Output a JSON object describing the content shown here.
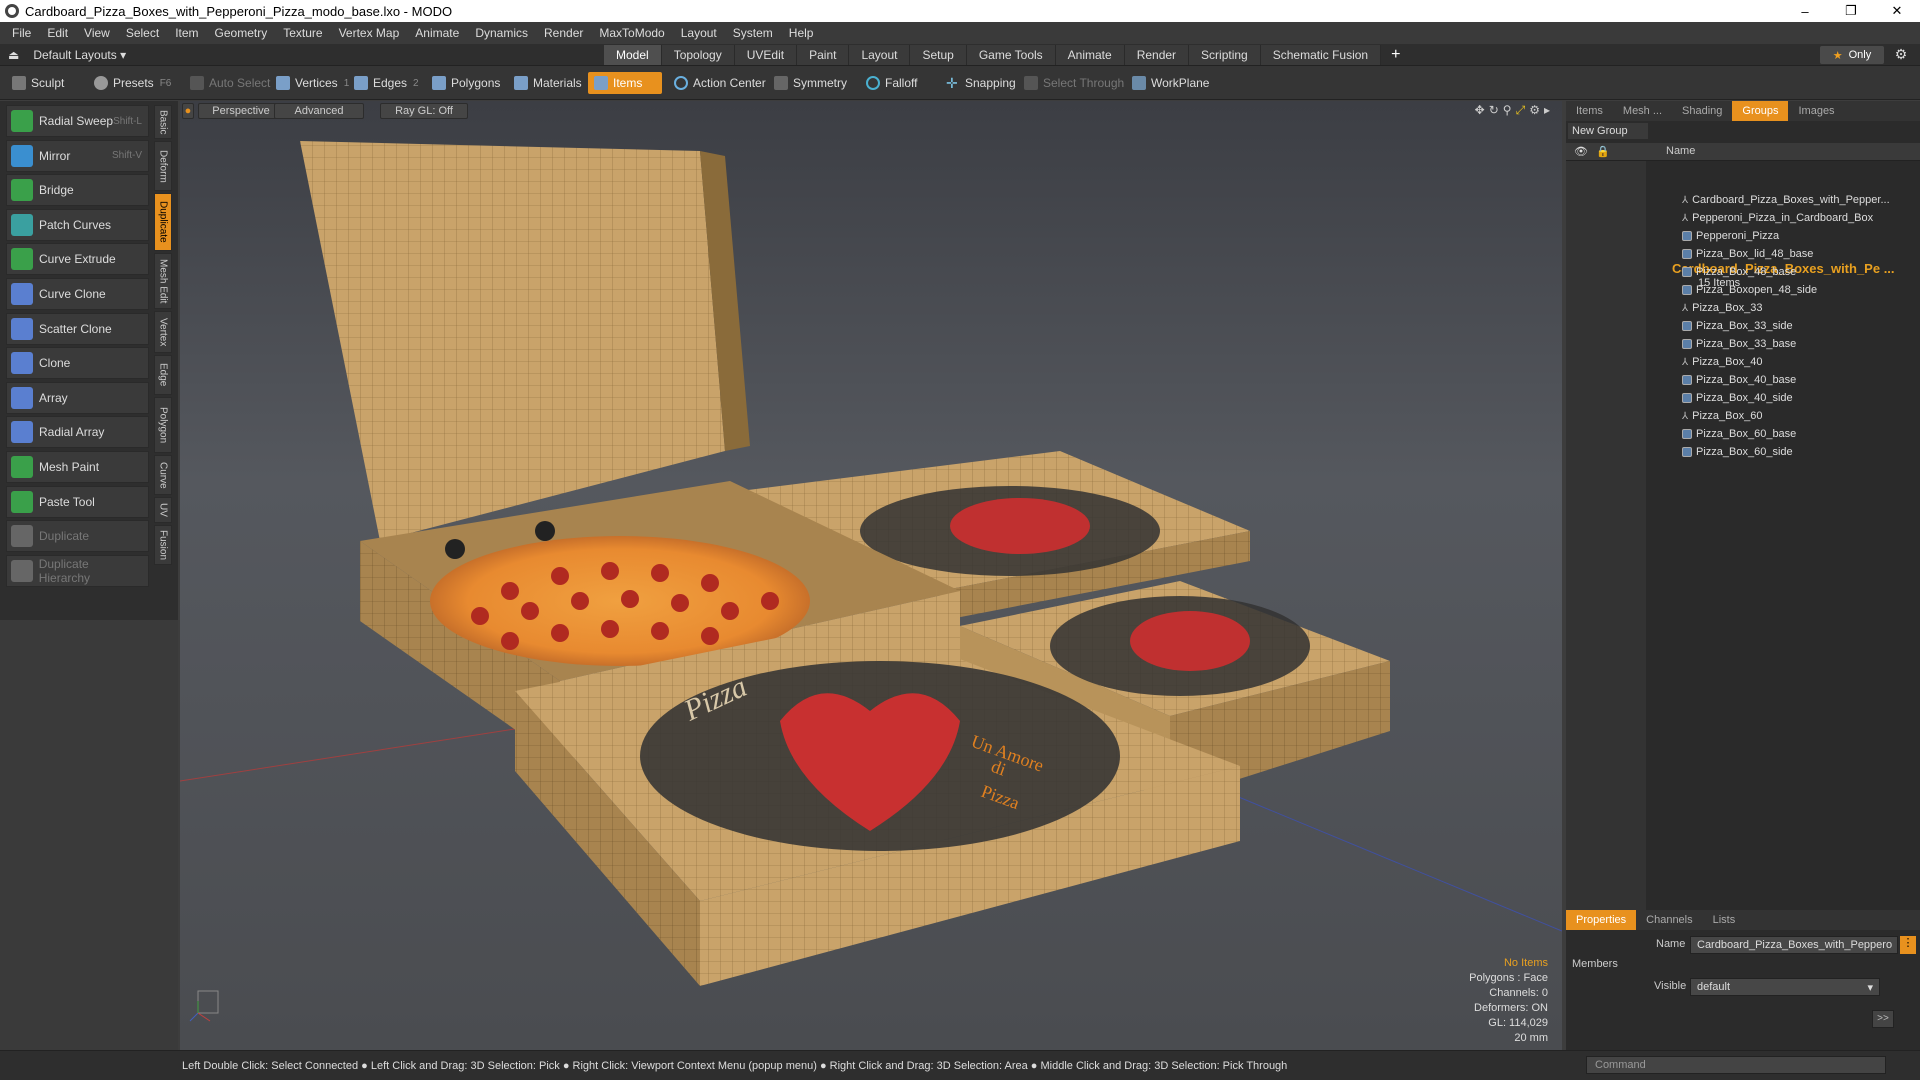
{
  "window": {
    "title": "Cardboard_Pizza_Boxes_with_Pepperoni_Pizza_modo_base.lxo - MODO",
    "minimize": "–",
    "restore": "❐",
    "close": "✕"
  },
  "menu": [
    "File",
    "Edit",
    "View",
    "Select",
    "Item",
    "Geometry",
    "Texture",
    "Vertex Map",
    "Animate",
    "Dynamics",
    "Render",
    "MaxToModo",
    "Layout",
    "System",
    "Help"
  ],
  "layouts": {
    "label": "Default Layouts ▾"
  },
  "mode_tabs": [
    {
      "label": "Model",
      "active": true
    },
    {
      "label": "Topology"
    },
    {
      "label": "UVEdit"
    },
    {
      "label": "Paint"
    },
    {
      "label": "Layout"
    },
    {
      "label": "Setup"
    },
    {
      "label": "Game Tools"
    },
    {
      "label": "Animate"
    },
    {
      "label": "Render"
    },
    {
      "label": "Scripting"
    },
    {
      "label": "Schematic Fusion"
    }
  ],
  "only_label": "Only",
  "toolbar": {
    "sculpt": "Sculpt",
    "presets": "Presets",
    "presets_key": "F6",
    "auto_select": "Auto Select",
    "vertices": "Vertices",
    "vertices_count": "1",
    "edges": "Edges",
    "edges_count": "2",
    "polygons": "Polygons",
    "materials": "Materials",
    "items": "Items",
    "action_center": "Action Center",
    "symmetry": "Symmetry",
    "falloff": "Falloff",
    "snapping": "Snapping",
    "select_through": "Select Through",
    "workplane": "WorkPlane"
  },
  "tools": [
    {
      "label": "Radial Sweep",
      "shortcut": "Shift-L",
      "color": "#3aa04a"
    },
    {
      "label": "Mirror",
      "shortcut": "Shift-V",
      "color": "#3a8fd0"
    },
    {
      "label": "Bridge",
      "shortcut": "",
      "color": "#3aa04a"
    },
    {
      "label": "Patch Curves",
      "shortcut": "",
      "color": "#3aa0a0"
    },
    {
      "label": "Curve Extrude",
      "shortcut": "",
      "color": "#3aa04a"
    },
    {
      "label": "Curve Clone",
      "shortcut": "",
      "color": "#5a7fd0"
    },
    {
      "label": "Scatter Clone",
      "shortcut": "",
      "color": "#5a7fd0"
    },
    {
      "label": "Clone",
      "shortcut": "",
      "color": "#5a7fd0"
    },
    {
      "label": "Array",
      "shortcut": "",
      "color": "#5a7fd0"
    },
    {
      "label": "Radial Array",
      "shortcut": "",
      "color": "#5a7fd0"
    },
    {
      "label": "Mesh Paint",
      "shortcut": "",
      "color": "#3aa04a"
    },
    {
      "label": "Paste Tool",
      "shortcut": "",
      "color": "#3aa04a"
    },
    {
      "label": "Duplicate",
      "shortcut": "",
      "color": "#666666",
      "disabled": true
    },
    {
      "label": "Duplicate Hierarchy",
      "shortcut": "",
      "color": "#666666",
      "disabled": true
    }
  ],
  "side_tabs": [
    {
      "label": "Basic"
    },
    {
      "label": "Deform"
    },
    {
      "label": "Duplicate",
      "active": true
    },
    {
      "label": "Mesh Edit"
    },
    {
      "label": "Vertex"
    },
    {
      "label": "Edge"
    },
    {
      "label": "Polygon"
    },
    {
      "label": "Curve"
    },
    {
      "label": "UV"
    },
    {
      "label": "Fusion"
    }
  ],
  "viewport": {
    "perspective": "Perspective",
    "advanced": "Advanced",
    "raygl": "Ray GL: Off",
    "stats": {
      "no_items": "No Items",
      "polygons": "Polygons : Face",
      "channels": "Channels: 0",
      "deformers": "Deformers: ON",
      "gl": "GL: 114,029",
      "scale": "20 mm"
    },
    "box_text": {
      "brand": "Pizza",
      "slogan1": "Un Amore",
      "slogan2": "di",
      "slogan3": "Pizza"
    }
  },
  "right_tabs": [
    {
      "label": "Items"
    },
    {
      "label": "Mesh ..."
    },
    {
      "label": "Shading"
    },
    {
      "label": "Groups",
      "active": true
    },
    {
      "label": "Images"
    }
  ],
  "new_group": "New Group",
  "list_header": "Name",
  "group": {
    "name": "Cardboard_Pizza_Boxes_with_Pe ...",
    "count": "15 Items"
  },
  "items": [
    {
      "label": "Cardboard_Pizza_Boxes_with_Pepper...",
      "type": "locator"
    },
    {
      "label": "Pepperoni_Pizza_in_Cardboard_Box",
      "type": "locator"
    },
    {
      "label": "Pepperoni_Pizza",
      "type": "mesh"
    },
    {
      "label": "Pizza_Box_lid_48_base",
      "type": "mesh"
    },
    {
      "label": "Pizza_Box_48_base",
      "type": "mesh"
    },
    {
      "label": "Pizza_Boxopen_48_side",
      "type": "mesh"
    },
    {
      "label": "Pizza_Box_33",
      "type": "locator"
    },
    {
      "label": "Pizza_Box_33_side",
      "type": "mesh"
    },
    {
      "label": "Pizza_Box_33_base",
      "type": "mesh"
    },
    {
      "label": "Pizza_Box_40",
      "type": "locator"
    },
    {
      "label": "Pizza_Box_40_base",
      "type": "mesh"
    },
    {
      "label": "Pizza_Box_40_side",
      "type": "mesh"
    },
    {
      "label": "Pizza_Box_60",
      "type": "locator"
    },
    {
      "label": "Pizza_Box_60_base",
      "type": "mesh"
    },
    {
      "label": "Pizza_Box_60_side",
      "type": "mesh"
    }
  ],
  "props": {
    "tabs": [
      {
        "label": "Properties",
        "active": true
      },
      {
        "label": "Channels"
      },
      {
        "label": "Lists"
      }
    ],
    "name_label": "Name",
    "name_value": "Cardboard_Pizza_Boxes_with_Peppero",
    "members": "Members",
    "visible_label": "Visible",
    "visible_value": "default",
    "more": ">>"
  },
  "status": {
    "hint": "Left Double Click: Select Connected ● Left Click and Drag: 3D Selection: Pick ● Right Click: Viewport Context Menu (popup menu) ● Right Click and Drag: 3D Selection: Area ● Middle Click and Drag: 3D Selection: Pick Through",
    "command_placeholder": "Command"
  }
}
